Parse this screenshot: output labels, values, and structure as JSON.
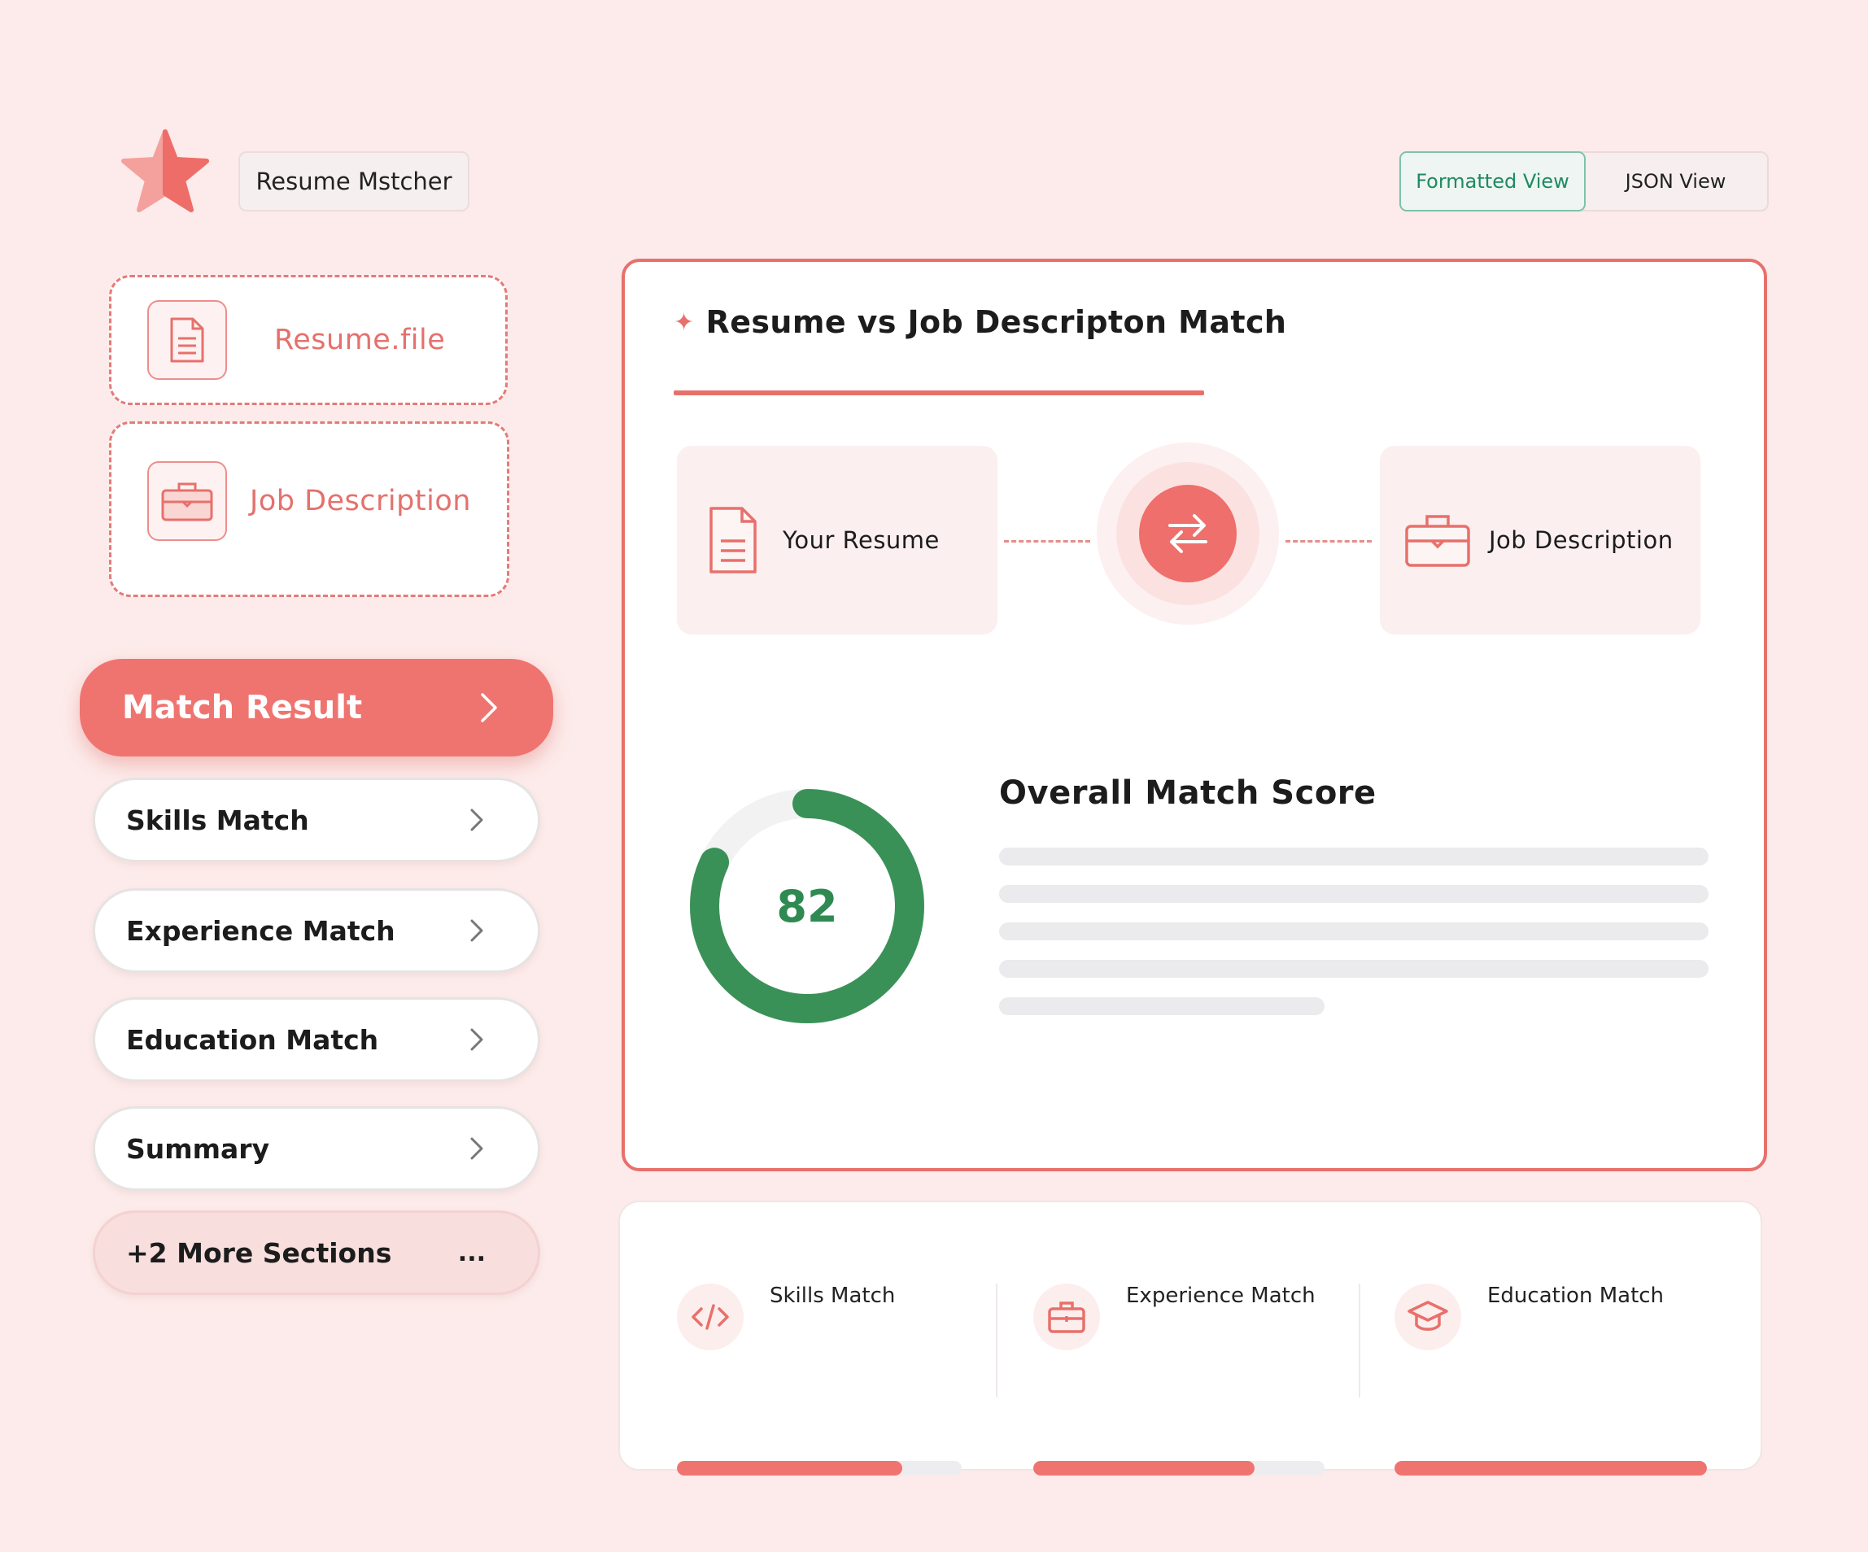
{
  "app": {
    "title": "Resume Mstcher",
    "logo_icon": "star-icon"
  },
  "view_toggle": {
    "options": [
      "Formatted View",
      "JSON View"
    ],
    "selected": "Formatted View"
  },
  "uploads": {
    "resume_label": "Resume.file",
    "resume_icon": "document-icon",
    "jd_label": "Job Description",
    "jd_icon": "briefcase-icon"
  },
  "nav": {
    "items": [
      {
        "label": "Match Result",
        "active": true,
        "icon": "chevron-right-icon"
      },
      {
        "label": "Skills Match",
        "icon": "chevron-right-icon"
      },
      {
        "label": "Experience Match",
        "icon": "chevron-right-icon"
      },
      {
        "label": "Education Match",
        "icon": "chevron-right-icon"
      },
      {
        "label": "Summary",
        "icon": "chevron-right-icon"
      }
    ],
    "more": {
      "label": "+2 More Sections",
      "ellipsis": "..."
    }
  },
  "main": {
    "title": "Resume vs Job Descripton Match",
    "title_icon": "sparkle-icon",
    "compare": {
      "left_label": "Your Resume",
      "right_label": "Job Description",
      "swap_icon": "swap-arrows-icon"
    },
    "score": {
      "title": "Overall Match Score",
      "value": "82",
      "fraction": 0.82
    }
  },
  "metrics": [
    {
      "label": "Skills Match",
      "icon": "code-icon",
      "fraction": 0.79
    },
    {
      "label": "Experience Match",
      "icon": "briefcase-icon",
      "fraction": 0.76
    },
    {
      "label": "Education Match",
      "icon": "graduation-cap-icon",
      "fraction": 1.0
    }
  ],
  "colors": {
    "accent": "#ef7470",
    "score_green": "#3a9157",
    "toggle_active": "#1f8a62",
    "background": "#fcebea"
  }
}
